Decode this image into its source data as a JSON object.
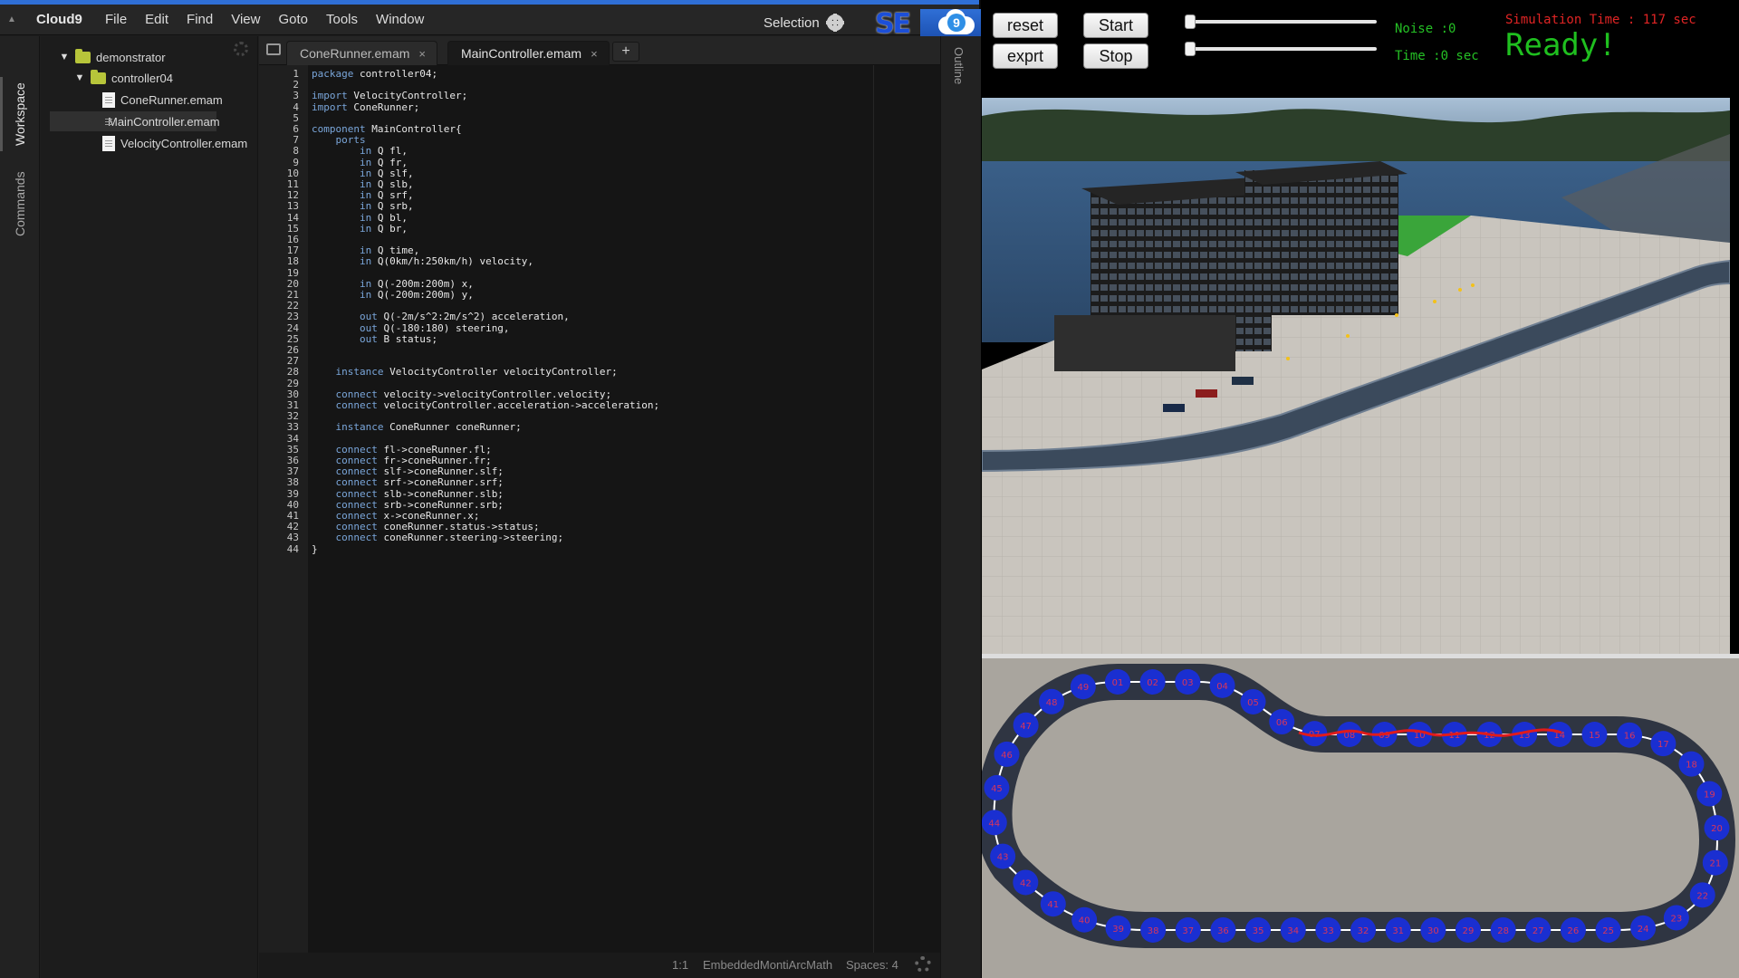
{
  "menubar": {
    "brand": "Cloud9",
    "items": [
      "File",
      "Edit",
      "Find",
      "View",
      "Goto",
      "Tools",
      "Window"
    ],
    "selection_label": "Selection",
    "logo_text": "SE",
    "cloud_badge": "9"
  },
  "side_tabs": {
    "workspace": "Workspace",
    "commands": "Commands"
  },
  "tree": {
    "root": "demonstrator",
    "folder": "controller04",
    "files": [
      "ConeRunner.emam",
      "MainController.emam",
      "VelocityController.emam"
    ]
  },
  "tabs": [
    {
      "label": "ConeRunner.emam",
      "active": false
    },
    {
      "label": "MainController.emam",
      "active": true
    }
  ],
  "tab_add": "+",
  "code_lines": [
    "package controller04;",
    "",
    "import VelocityController;",
    "import ConeRunner;",
    "",
    "component MainController{",
    "    ports",
    "        in Q fl,",
    "        in Q fr,",
    "        in Q slf,",
    "        in Q slb,",
    "        in Q srf,",
    "        in Q srb,",
    "        in Q bl,",
    "        in Q br,",
    "",
    "        in Q time,",
    "        in Q(0km/h:250km/h) velocity,",
    "",
    "        in Q(-200m:200m) x,",
    "        in Q(-200m:200m) y,",
    "",
    "        out Q(-2m/s^2:2m/s^2) acceleration,",
    "        out Q(-180:180) steering,",
    "        out B status;",
    "",
    "",
    "    instance VelocityController velocityController;",
    "",
    "    connect velocity->velocityController.velocity;",
    "    connect velocityController.acceleration->acceleration;",
    "",
    "    instance ConeRunner coneRunner;",
    "",
    "    connect fl->coneRunner.fl;",
    "    connect fr->coneRunner.fr;",
    "    connect slf->coneRunner.slf;",
    "    connect srf->coneRunner.srf;",
    "    connect slb->coneRunner.slb;",
    "    connect srb->coneRunner.srb;",
    "    connect x->coneRunner.x;",
    "    connect coneRunner.status->status;",
    "    connect coneRunner.steering->steering;",
    "}"
  ],
  "status": {
    "position": "1:1",
    "mode": "EmbeddedMontiArcMath",
    "spaces": "Spaces: 4"
  },
  "outline_label": "Outline",
  "sim": {
    "buttons": {
      "reset": "reset",
      "start": "Start",
      "exprt": "exprt",
      "stop": "Stop"
    },
    "noise": "Noise :0",
    "time": "Time :0 sec",
    "noise_value": 0,
    "time_value": 0,
    "sim_time": "Simulation Time : 117 sec",
    "ready": "Ready!"
  },
  "track": {
    "cone_labels": [
      "01",
      "02",
      "03",
      "04",
      "05",
      "06",
      "07",
      "08",
      "09",
      "10",
      "11",
      "12",
      "13",
      "14",
      "15",
      "16",
      "17",
      "18",
      "19",
      "20",
      "21",
      "22",
      "23",
      "24",
      "25",
      "26",
      "27",
      "28",
      "29",
      "30",
      "31",
      "32",
      "33",
      "34",
      "35",
      "36",
      "37",
      "38",
      "39",
      "40",
      "41",
      "42",
      "43",
      "44",
      "45",
      "46",
      "47",
      "48",
      "49"
    ]
  }
}
